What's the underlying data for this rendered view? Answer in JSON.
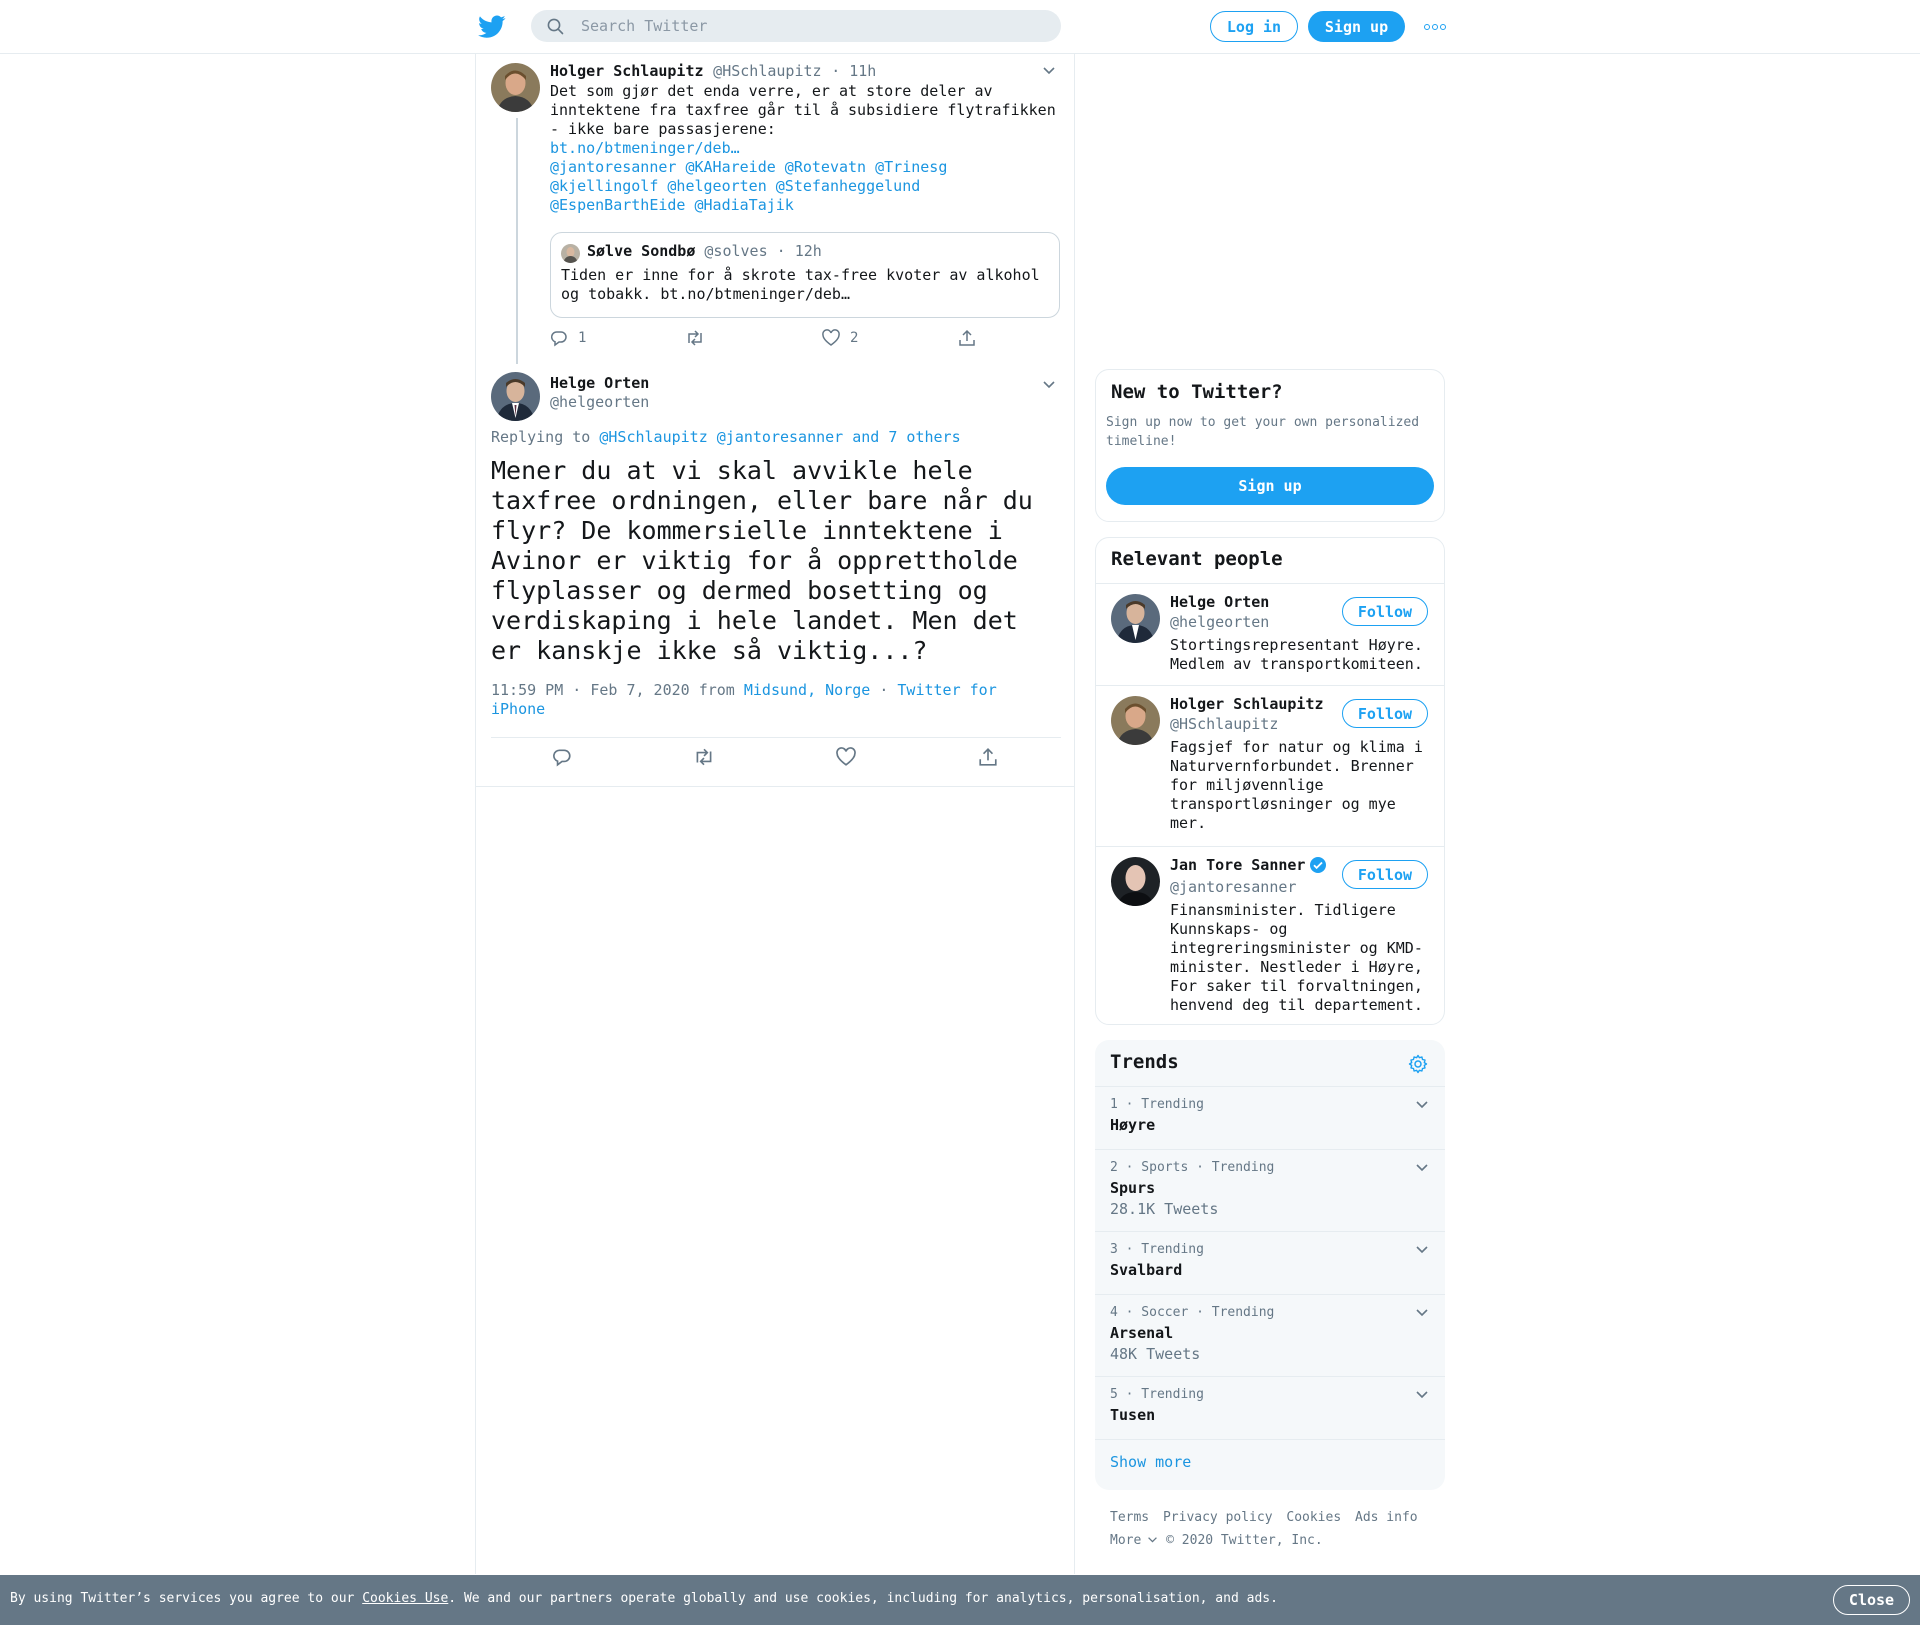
{
  "header": {
    "search_placeholder": "Search Twitter",
    "login_label": "Log in",
    "signup_label": "Sign up",
    "logo_icon": "twitter-bird-icon",
    "more_icon": "more-dots-icon"
  },
  "parent_tweet": {
    "name": "Holger Schlaupitz",
    "handle": "@HSchlaupitz",
    "time": "· 11h",
    "text": "Det som gjør det enda verre, er at store deler av inntektene fra taxfree går til å subsidiere flytrafikken - ikke bare passasjerene:",
    "link": "bt.no/btmeninger/deb…",
    "mentions_line1": "@jantoresanner @KAHareide @Rotevatn @Trinesg",
    "mentions_line2": "@kjellingolf @helgeorten @Stefanheggelund",
    "mentions_line3": "@EspenBarthEide @HadiaTajik",
    "quote": {
      "name": "Sølve Sondbø",
      "handle": "@solves",
      "time": "· 12h",
      "text": "Tiden er inne for å skrote tax-free kvoter av alkohol og tobakk. bt.no/btmeninger/deb…"
    },
    "reply_count": "1",
    "like_count": "2"
  },
  "main_tweet": {
    "name": "Helge Orten",
    "handle": "@helgeorten",
    "replying_prefix": "Replying to",
    "replying_to": "@HSchlaupitz @jantoresanner and 7 others",
    "text": "Mener du at vi skal avvikle hele taxfree ordningen, eller bare når du flyr? De kommersielle inntektene i Avinor er viktig for å opprettholde flyplasser og dermed bosetting og verdiskaping i hele landet. Men det er kanskje ikke så viktig...?",
    "timestamp": "11:59 PM · Feb 7, 2020 from",
    "location": "Midsund, Norge",
    "separator": "·",
    "source": "Twitter for iPhone"
  },
  "new_to_twitter": {
    "title": "New to Twitter?",
    "text": "Sign up now to get your own personalized timeline!",
    "button": "Sign up"
  },
  "relevant_people": {
    "title": "Relevant people",
    "follow_label": "Follow",
    "people": [
      {
        "name": "Helge Orten",
        "handle": "@helgeorten",
        "bio": "Stortingsrepresentant Høyre. Medlem av transportkomiteen."
      },
      {
        "name": "Holger Schlaupitz",
        "handle": "@HSchlaupitz",
        "bio": "Fagsjef for natur og klima i Naturvernforbundet. Brenner for miljøvennlige transportløsninger og mye mer."
      },
      {
        "name": "Jan Tore Sanner",
        "handle": "@jantoresanner",
        "bio": "Finansminister. Tidligere Kunnskaps- og integreringsminister og KMD-minister. Nestleder i Høyre, For saker til forvaltningen, henvend deg til departement."
      }
    ]
  },
  "trends": {
    "title": "Trends",
    "items": [
      {
        "meta": "1 · Trending",
        "name": "Høyre",
        "count": ""
      },
      {
        "meta": "2 · Sports · Trending",
        "name": "Spurs",
        "count": "28.1K Tweets"
      },
      {
        "meta": "3 · Trending",
        "name": "Svalbard",
        "count": ""
      },
      {
        "meta": "4 · Soccer · Trending",
        "name": "Arsenal",
        "count": "48K Tweets"
      },
      {
        "meta": "5 · Trending",
        "name": "Tusen",
        "count": ""
      }
    ],
    "show_more": "Show more"
  },
  "footer": {
    "terms": "Terms",
    "privacy": "Privacy policy",
    "cookies": "Cookies",
    "ads": "Ads info",
    "more": "More",
    "copyright": "© 2020 Twitter, Inc."
  },
  "cookie_bar": {
    "text_before": "By using Twitter’s services you agree to our",
    "link": "Cookies Use",
    "text_after": ". We and our partners operate globally and use cookies, including for analytics, personalisation, and ads.",
    "close": "Close"
  },
  "colors": {
    "brand": "#1da1f2",
    "link": "#1b95e0",
    "secondary_text": "#657786",
    "cookie_bar": "#657786"
  }
}
